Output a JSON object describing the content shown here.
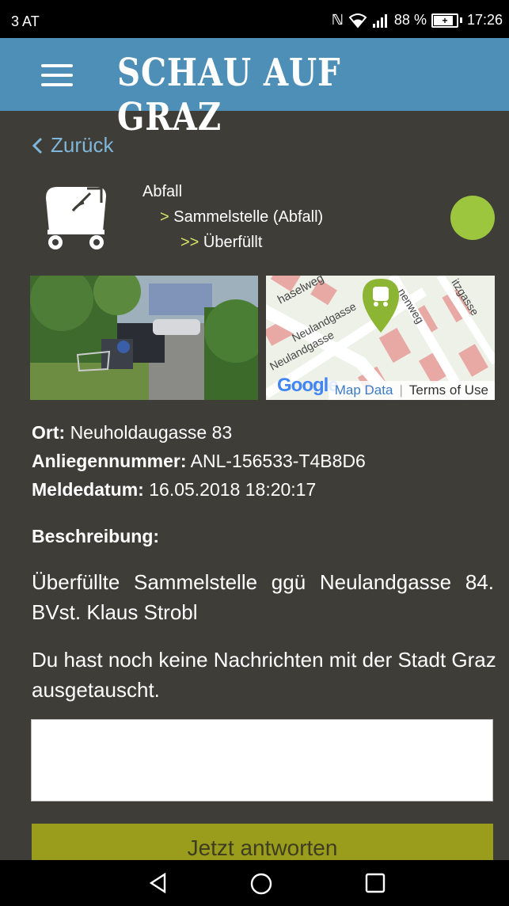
{
  "status_bar": {
    "carrier": "3 AT",
    "nfc": "ℕ",
    "battery_percent": "88 %",
    "time": "17:26"
  },
  "header": {
    "title": "SCHAU AUF GRAZ",
    "menu_icon": "hamburger-menu-icon"
  },
  "back": {
    "label": "Zurück"
  },
  "category": {
    "icon": "waste-container-icon",
    "level1": "Abfall",
    "level2_arrow": ">",
    "level2": "Sammelstelle (Abfall)",
    "level3_arrow": ">>",
    "level3": "Überfüllt",
    "status_color": "#9dc63f"
  },
  "map": {
    "streets": [
      "haselweg",
      "Neulandgasse",
      "Neulandgasse",
      "nenweg",
      "itzgasse"
    ],
    "google_logo": "Google",
    "map_data_label": "Map Data",
    "terms_label": "Terms of Use"
  },
  "details": {
    "ort_label": "Ort:",
    "ort_value": "Neuholdaugasse 83",
    "anliegen_label": "Anliegennummer:",
    "anliegen_value": "ANL-156533-T4B8D6",
    "datum_label": "Meldedatum:",
    "datum_value": "16.05.2018 18:20:17"
  },
  "description": {
    "title": "Beschreibung:",
    "text": "Überfüllte Sammelstelle ggü Neulandgasse 84. BVst. Klaus Strobl"
  },
  "messages": {
    "empty_text": "Du hast noch keine Nachrichten mit der Stadt Graz ausgetauscht.",
    "reply_value": "",
    "reply_button": "Jetzt antworten"
  },
  "colors": {
    "header_bg": "#4d8fb6",
    "page_bg": "#3f3d38",
    "accent_link": "#7fb6d9",
    "button_bg": "#9a9c1c"
  }
}
